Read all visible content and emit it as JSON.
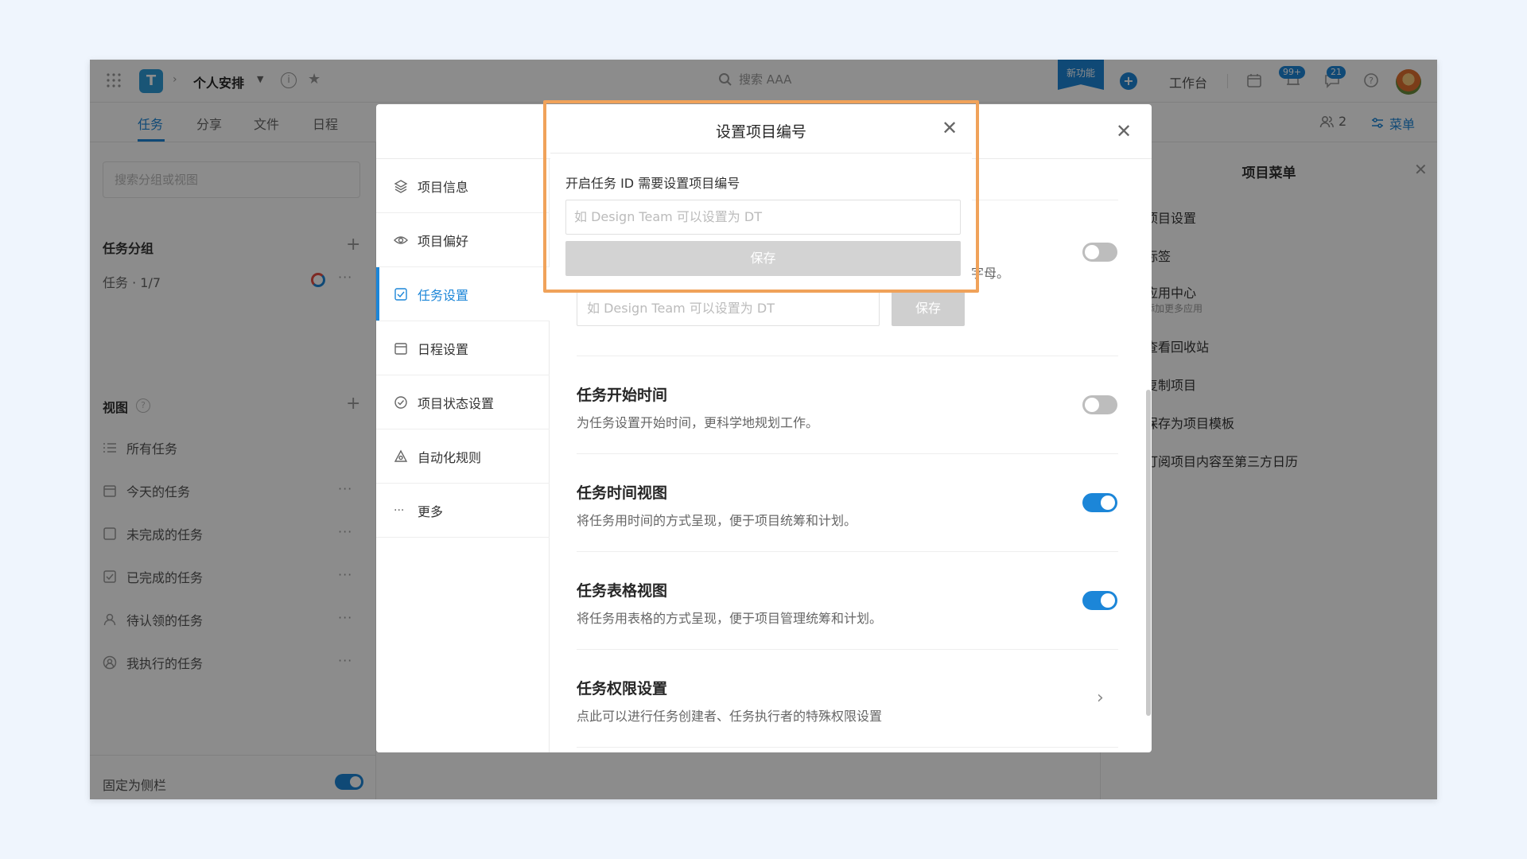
{
  "colors": {
    "accent": "#1c86d8",
    "highlight_frame": "#f0a25a",
    "backdrop": "#eff5fd"
  },
  "topbar": {
    "project_name": "个人安排",
    "search_placeholder": "搜索 AAA",
    "new_feature_badge": "新功能",
    "workbench": "工作台",
    "notifications_badge": "99+",
    "messages_badge": "21"
  },
  "tabs": [
    "任务",
    "分享",
    "文件",
    "日程"
  ],
  "members_count": "2",
  "menu_label": "菜单",
  "sidebar": {
    "search_placeholder": "搜索分组或视图",
    "groups_title": "任务分组",
    "task_group": "任务 · 1/7",
    "views_title": "视图",
    "views": [
      "所有任务",
      "今天的任务",
      "未完成的任务",
      "已完成的任务",
      "待认领的任务",
      "我执行的任务"
    ],
    "pin_label": "固定为侧栏"
  },
  "project_menu": {
    "title": "项目菜单",
    "items": [
      "项目设置",
      "标签",
      "应用中心",
      "查看回收站",
      "复制项目",
      "保存为项目模板",
      "订阅项目内容至第三方日历"
    ],
    "app_center_sub": "添加更多应用"
  },
  "settings": {
    "nav": [
      "项目信息",
      "项目偏好",
      "任务设置",
      "日程设置",
      "项目状态设置",
      "自动化规则",
      "更多"
    ],
    "active_nav": "任务设置",
    "partial_text": "字母。",
    "id_input_placeholder": "如 Design Team 可以设置为 DT",
    "id_save": "保存",
    "rows": [
      {
        "title": "任务开始时间",
        "desc": "为任务设置开始时间，更科学地规划工作。",
        "enabled": false
      },
      {
        "title": "任务时间视图",
        "desc": "将任务用时间的方式呈现，便于项目统筹和计划。",
        "enabled": true
      },
      {
        "title": "任务表格视图",
        "desc": "将任务用表格的方式呈现，便于项目管理统筹和计划。",
        "enabled": true
      },
      {
        "title": "任务权限设置",
        "desc": "点此可以进行任务创建者、任务执行者的特殊权限设置"
      }
    ]
  },
  "dialog": {
    "title": "设置项目编号",
    "label": "开启任务 ID 需要设置项目编号",
    "placeholder": "如 Design Team 可以设置为 DT",
    "save": "保存"
  }
}
